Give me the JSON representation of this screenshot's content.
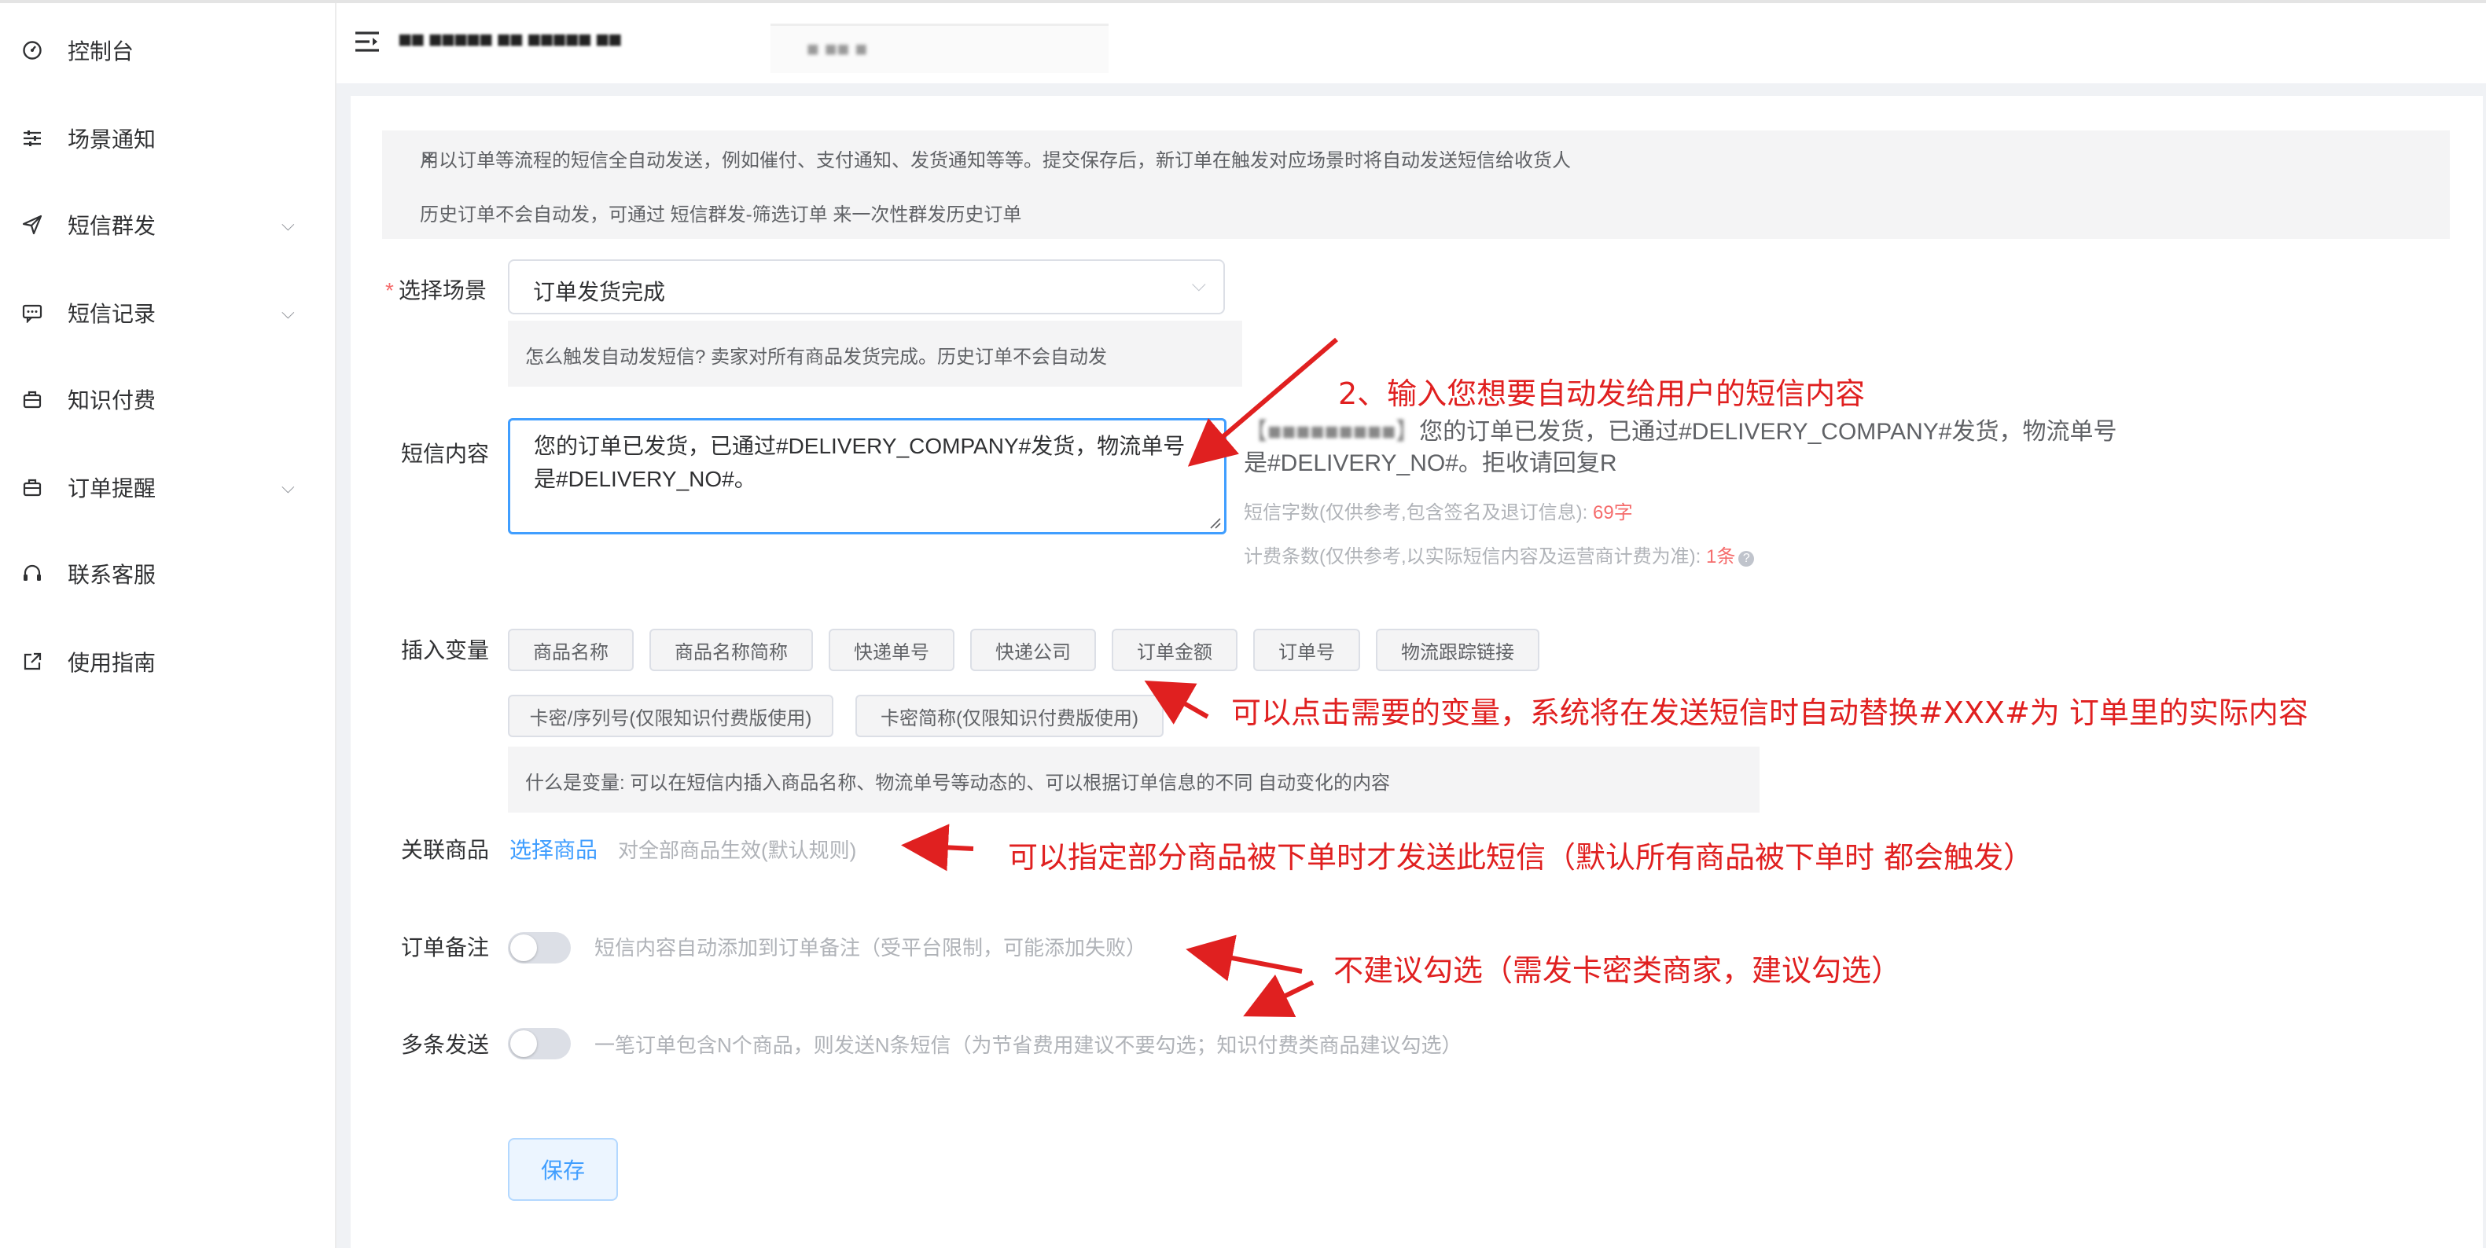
{
  "sidebar": {
    "items": [
      {
        "label": "控制台",
        "icon": "dashboard-icon",
        "has_chevron": false
      },
      {
        "label": "场景通知",
        "icon": "sliders-icon",
        "has_chevron": false
      },
      {
        "label": "短信群发",
        "icon": "send-icon",
        "has_chevron": true
      },
      {
        "label": "短信记录",
        "icon": "message-icon",
        "has_chevron": true
      },
      {
        "label": "知识付费",
        "icon": "briefcase-icon",
        "has_chevron": false
      },
      {
        "label": "订单提醒",
        "icon": "briefcase-icon",
        "has_chevron": true
      },
      {
        "label": "联系客服",
        "icon": "headset-icon",
        "has_chevron": false
      },
      {
        "label": "使用指南",
        "icon": "external-link-icon",
        "has_chevron": false
      }
    ]
  },
  "header": {
    "title": "■■ ■■■■■ ■■ ■■■■■ ■■",
    "tab": "■ ■■ ■"
  },
  "alerts": {
    "line1": "用以订单等流程的短信全自动发送，例如催付、支付通知、发货通知等等。提交保存后，新订单在触发对应场景时将自动发送短信给收货人",
    "line2": "历史订单不会自动发，可通过 短信群发-筛选订单 来一次性群发历史订单",
    "close": "×"
  },
  "form": {
    "scene": {
      "required_mark": "*",
      "label": "选择场景",
      "value": "订单发货完成",
      "hint": "怎么触发自动发短信? 卖家对所有商品发货完成。历史订单不会自动发"
    },
    "content": {
      "label": "短信内容",
      "value": "您的订单已发货，已通过#DELIVERY_COMPANY#发货，物流单号是#DELIVERY_NO#。",
      "preview_blur": "【■■■■■■■■■】",
      "preview_text": "您的订单已发货，已通过#DELIVERY_COMPANY#发货，物流单号是#DELIVERY_NO#。拒收请回复R",
      "chars_label": "短信字数(仅供参考,包含签名及退订信息): ",
      "chars_value": "69字",
      "count_label": "计费条数(仅供参考,以实际短信内容及运营商计费为准): ",
      "count_value": "1条"
    },
    "variables": {
      "label": "插入变量",
      "buttons": [
        "商品名称",
        "商品名称简称",
        "快递单号",
        "快递公司",
        "订单金额",
        "订单号",
        "物流跟踪链接",
        "卡密/序列号(仅限知识付费版使用)",
        "卡密简称(仅限知识付费版使用)"
      ],
      "hint": "什么是变量: 可以在短信内插入商品名称、物流单号等动态的、可以根据订单信息的不同 自动变化的内容"
    },
    "products": {
      "label": "关联商品",
      "link": "选择商品",
      "note": "对全部商品生效(默认规则)"
    },
    "remark": {
      "label": "订单备注",
      "on": false,
      "note": "短信内容自动添加到订单备注（受平台限制，可能添加失败）"
    },
    "multi": {
      "label": "多条发送",
      "on": false,
      "note": "一笔订单包含N个商品，则发送N条短信（为节省费用建议不要勾选；知识付费类商品建议勾选）"
    },
    "save_label": "保存"
  },
  "annotations": {
    "a1": "2、输入您想要自动发给用户的短信内容",
    "a2": "可以点击需要的变量，系统将在发送短信时自动替换#XXX#为 订单里的实际内容",
    "a3": "可以指定部分商品被下单时才发送此短信（默认所有商品被下单时 都会触发）",
    "a4": "不建议勾选（需发卡密类商家，建议勾选）",
    "color": "#e02020"
  }
}
